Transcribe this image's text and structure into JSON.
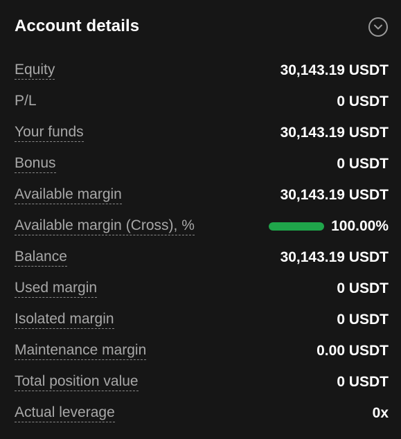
{
  "header": {
    "title": "Account details",
    "collapse_icon": "chevron-down-circle-icon"
  },
  "colors": {
    "background": "#161616",
    "label": "#a8a8a8",
    "value": "#ffffff",
    "bar_fill": "#1fa54a"
  },
  "rows": [
    {
      "label": "Equity",
      "value": "30,143.19 USDT"
    },
    {
      "label": "P/L",
      "value": "0 USDT"
    },
    {
      "label": "Your funds",
      "value": "30,143.19 USDT"
    },
    {
      "label": "Bonus",
      "value": "0 USDT"
    },
    {
      "label": "Available margin",
      "value": "30,143.19 USDT"
    },
    {
      "label": "Available margin (Cross), %",
      "value": "100.00%",
      "progress_percent": 100
    },
    {
      "label": "Balance",
      "value": "30,143.19 USDT"
    },
    {
      "label": "Used margin",
      "value": "0 USDT"
    },
    {
      "label": "Isolated margin",
      "value": "0 USDT"
    },
    {
      "label": "Maintenance margin",
      "value": "0.00 USDT"
    },
    {
      "label": "Total position value",
      "value": "0 USDT"
    },
    {
      "label": "Actual leverage",
      "value": "0x"
    }
  ]
}
